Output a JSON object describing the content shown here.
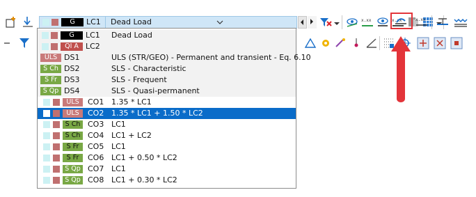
{
  "combo": {
    "selected_type": "G",
    "selected_id": "LC1",
    "selected_name": "Dead Load"
  },
  "dropdown": {
    "rows": [
      {
        "kind": "load-case",
        "type": "G",
        "type_bg": "#000000",
        "type_fg": "#ffffff",
        "id": "LC1",
        "name": "Dead Load",
        "cyan": "#ccf1f3",
        "color": "#c07070",
        "section": "lc"
      },
      {
        "kind": "load-case",
        "type": "QI A",
        "type_bg": "#c0504d",
        "type_fg": "#ffffff",
        "id": "LC2",
        "name": "",
        "cyan": "#ccf1f3",
        "color": "#c07070",
        "section": "lc"
      },
      {
        "kind": "design-situation",
        "type": "ULS",
        "type_bg": "#c97a7a",
        "type_fg": "#ffffff",
        "id": "DS1",
        "name": "ULS (STR/GEO) - Permanent and transient - Eq. 6.10",
        "section": "ds"
      },
      {
        "kind": "design-situation",
        "type": "S Ch",
        "type_bg": "#79a845",
        "type_fg": "#ffffff",
        "id": "DS2",
        "name": "SLS - Characteristic",
        "section": "ds"
      },
      {
        "kind": "design-situation",
        "type": "S Fr",
        "type_bg": "#79a845",
        "type_fg": "#ffffff",
        "id": "DS3",
        "name": "SLS - Frequent",
        "section": "ds"
      },
      {
        "kind": "design-situation",
        "type": "S Qp",
        "type_bg": "#79a845",
        "type_fg": "#ffffff",
        "id": "DS4",
        "name": "SLS - Quasi-permanent",
        "section": "ds"
      },
      {
        "kind": "combination",
        "type": "ULS",
        "type_bg": "#c97a7a",
        "type_fg": "#ffffff",
        "id": "CO1",
        "name": "1.35 * LC1",
        "selected": false
      },
      {
        "kind": "combination",
        "type": "ULS",
        "type_bg": "#c97a7a",
        "type_fg": "#ffffff",
        "id": "CO2",
        "name": "1.35 * LC1 + 1.50 * LC2",
        "selected": true
      },
      {
        "kind": "combination",
        "type": "S Ch",
        "type_bg": "#79a845",
        "type_fg": "#111111",
        "id": "CO3",
        "name": "LC1",
        "selected": false
      },
      {
        "kind": "combination",
        "type": "S Ch",
        "type_bg": "#79a845",
        "type_fg": "#111111",
        "id": "CO4",
        "name": "LC1 + LC2",
        "selected": false
      },
      {
        "kind": "combination",
        "type": "S Fr",
        "type_bg": "#79a845",
        "type_fg": "#111111",
        "id": "CO5",
        "name": "LC1",
        "selected": false
      },
      {
        "kind": "combination",
        "type": "S Fr",
        "type_bg": "#79a845",
        "type_fg": "#111111",
        "id": "CO6",
        "name": "LC1 + 0.50 * LC2",
        "selected": false
      },
      {
        "kind": "combination",
        "type": "S Qp",
        "type_bg": "#79a845",
        "type_fg": "#ffffff",
        "id": "CO7",
        "name": "LC1",
        "selected": false
      },
      {
        "kind": "combination",
        "type": "S Qp",
        "type_bg": "#79a845",
        "type_fg": "#ffffff",
        "id": "CO8",
        "name": "LC1 + 0.30 * LC2",
        "selected": false
      }
    ]
  },
  "colors": {
    "selection": "#0a6cc9",
    "highlight_red": "#e3343a",
    "cyan_square": "#ccf1f3",
    "lc_color_square": "#c07070"
  },
  "icons": {
    "toolbar_top": [
      "new-load-icon",
      "load-down-icon",
      "filter-x-icon",
      "result-eye-icon",
      "result-values-icon",
      "result-eye-2-icon",
      "result-values-2-icon",
      "member-grey-icon",
      "grid-blue-icon",
      "deformation-scale-icon",
      "values-line-icon",
      "member-result-icon",
      "diagram-icon"
    ],
    "toolbar_second": [
      "filter-icon",
      "section-icon",
      "gear-icon",
      "view-icon",
      "pin-icon",
      "angle-icon",
      "grid-icon",
      "center-icon",
      "snap-icon",
      "view-3d-icon",
      "view-3d-2-icon"
    ]
  }
}
